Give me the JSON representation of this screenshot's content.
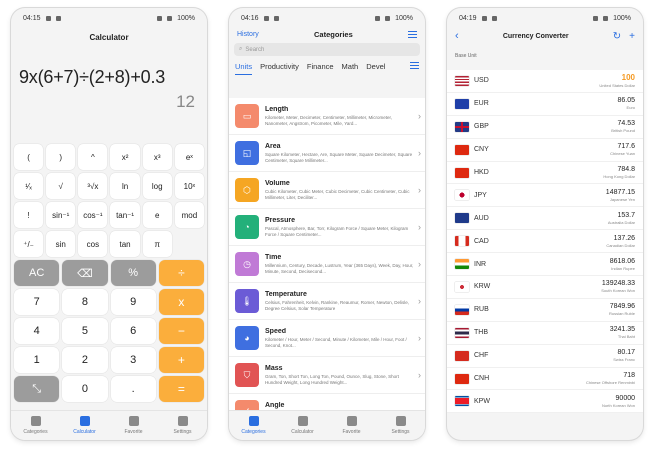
{
  "calculator": {
    "status": {
      "time": "04:15",
      "battery": "100%"
    },
    "title": "Calculator",
    "expression": "9x(6+7)÷(2+8)+0.3",
    "result": "12",
    "sci_keys": [
      "(",
      ")",
      "^",
      "x²",
      "x³",
      "eˣ",
      "¹⁄ₓ",
      "√",
      "³√x",
      "ln",
      "log",
      "10ˣ",
      "!",
      "sin⁻¹",
      "cos⁻¹",
      "tan⁻¹",
      "e",
      "mod",
      "⁺/₋",
      "sin",
      "cos",
      "tan",
      "π",
      ""
    ],
    "main_keys": [
      {
        "label": "AC",
        "style": "gray"
      },
      {
        "label": "⌫",
        "style": "gray"
      },
      {
        "label": "%",
        "style": "gray"
      },
      {
        "label": "÷",
        "style": "orange"
      },
      {
        "label": "7",
        "style": "white"
      },
      {
        "label": "8",
        "style": "white"
      },
      {
        "label": "9",
        "style": "white"
      },
      {
        "label": "x",
        "style": "orange"
      },
      {
        "label": "4",
        "style": "white"
      },
      {
        "label": "5",
        "style": "white"
      },
      {
        "label": "6",
        "style": "white"
      },
      {
        "label": "−",
        "style": "orange"
      },
      {
        "label": "1",
        "style": "white"
      },
      {
        "label": "2",
        "style": "white"
      },
      {
        "label": "3",
        "style": "white"
      },
      {
        "label": "+",
        "style": "orange"
      },
      {
        "label": "⤡",
        "style": "gray"
      },
      {
        "label": "0",
        "style": "white"
      },
      {
        "label": ".",
        "style": "white"
      },
      {
        "label": "=",
        "style": "orange"
      }
    ]
  },
  "categories_screen": {
    "status": {
      "time": "04:16",
      "battery": "100%"
    },
    "history_label": "History",
    "title": "Categories",
    "search_placeholder": "Search",
    "tabs": [
      "Units",
      "Productivity",
      "Finance",
      "Math",
      "Devel"
    ],
    "items": [
      {
        "name": "Length",
        "desc": "Kilometer, Meter, Decimeter, Centimeter, Millimeter, Micrometer, Nanometer, Angstrom, Picometer, Mile, Yard...",
        "color": "#f48a6c",
        "glyph": "▭"
      },
      {
        "name": "Area",
        "desc": "Square Kilometer, Hectare, Are, Square Meter, Square Decimeter, Square Centimeter, Square Millimeter...",
        "color": "#3f6fe0",
        "glyph": "◱"
      },
      {
        "name": "Volume",
        "desc": "Cubic Kilometer, Cubic Meter, Cubic Decimeter, Cubic Centimeter, Cubic Millimeter, Liter, Deciliter...",
        "color": "#f5a623",
        "glyph": "⬡"
      },
      {
        "name": "Pressure",
        "desc": "Pascal, Atmosphere, Bar, Torr, Kilogram Force / Square Meter, Kilogram Force / Square Centimeter...",
        "color": "#23b07a",
        "glyph": "◔"
      },
      {
        "name": "Time",
        "desc": "Millennium, Century, Decade, Lustrum, Year (365 Days), Week, Day, Hour, Minute, Second, Decisecond...",
        "color": "#c07ad6",
        "glyph": "◷"
      },
      {
        "name": "Temperature",
        "desc": "Celsius, Fahrenheit, Kelvin, Rankine, Reaumur, Romer, Newton, Delisle, Degree Celsius, Solar Temperature",
        "color": "#6b5bd6",
        "glyph": "🌡"
      },
      {
        "name": "Speed",
        "desc": "Kilometer / Hour, Meter / Second, Minute / Kilometer, Mile / Hour, Foot / Second, Knot...",
        "color": "#3f6fe0",
        "glyph": "◕"
      },
      {
        "name": "Mass",
        "desc": "Gram, Ton, Short Ton, Long Ton, Pound, Ounce, Slug, Stone, Short Hundred Weight, Long Hundred Weight...",
        "color": "#e15454",
        "glyph": "⛉"
      },
      {
        "name": "Angle",
        "desc": "",
        "color": "#f48a6c",
        "glyph": "∠"
      }
    ]
  },
  "currency": {
    "status": {
      "time": "04:19",
      "battery": "100%"
    },
    "title": "Currency Converter",
    "base_label": "Base Unit",
    "rates": [
      {
        "code": "USD",
        "value": "100",
        "name": "United States Dollar",
        "flag": "us"
      },
      {
        "code": "EUR",
        "value": "86.05",
        "name": "Euro",
        "flag": "eu"
      },
      {
        "code": "GBP",
        "value": "74.53",
        "name": "British Pound",
        "flag": "gb"
      },
      {
        "code": "CNY",
        "value": "717.6",
        "name": "Chinese Yuan",
        "flag": "cn"
      },
      {
        "code": "HKD",
        "value": "784.8",
        "name": "Hong Kong Dollar",
        "flag": "hk"
      },
      {
        "code": "JPY",
        "value": "14877.15",
        "name": "Japanese Yen",
        "flag": "jp"
      },
      {
        "code": "AUD",
        "value": "153.7",
        "name": "Australia Dollar",
        "flag": "au"
      },
      {
        "code": "CAD",
        "value": "137.26",
        "name": "Canadian Dollar",
        "flag": "ca"
      },
      {
        "code": "INR",
        "value": "8618.06",
        "name": "Indian Rupee",
        "flag": "in"
      },
      {
        "code": "KRW",
        "value": "139248.33",
        "name": "South Korean Won",
        "flag": "kr"
      },
      {
        "code": "RUB",
        "value": "7849.96",
        "name": "Russian Ruble",
        "flag": "ru"
      },
      {
        "code": "THB",
        "value": "3241.35",
        "name": "Thai Baht",
        "flag": "th"
      },
      {
        "code": "CHF",
        "value": "80.17",
        "name": "Swiss Franc",
        "flag": "ch"
      },
      {
        "code": "CNH",
        "value": "718",
        "name": "Chinese Offshore Renminbi",
        "flag": "cn"
      },
      {
        "code": "KPW",
        "value": "90000",
        "name": "North Korean Won",
        "flag": "kp"
      }
    ]
  },
  "nav": [
    {
      "label": "Categories",
      "icon": "cube-icon"
    },
    {
      "label": "Calculator",
      "icon": "calculator-icon"
    },
    {
      "label": "Favorite",
      "icon": "heart-icon"
    },
    {
      "label": "Settings",
      "icon": "gear-icon"
    }
  ],
  "colors": {
    "accent": "#2a6ee0",
    "operator": "#fbae3c",
    "highlight": "#f59a23"
  }
}
